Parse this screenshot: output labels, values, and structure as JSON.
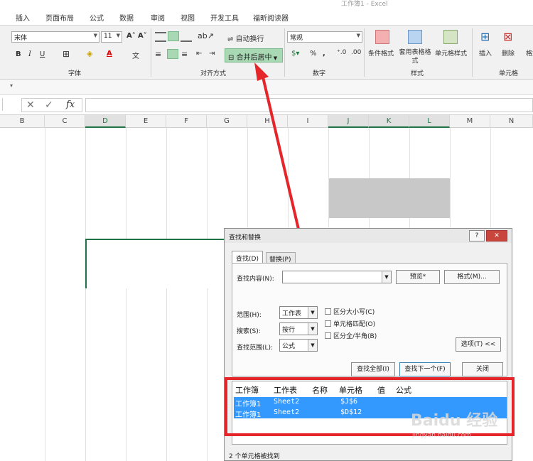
{
  "window": {
    "title": "工作簿1 - Excel"
  },
  "tabs": [
    "插入",
    "页面布局",
    "公式",
    "数据",
    "审阅",
    "视图",
    "开发工具",
    "福昕阅读器"
  ],
  "ribbon": {
    "font_name": "宋体",
    "font_size": "11",
    "wrap_text": "自动换行",
    "merge_center": "合并后居中",
    "number_format": "常规",
    "groups": {
      "font": "字体",
      "alignment": "对齐方式",
      "number": "数字",
      "styles": "样式",
      "cells": "单元格"
    },
    "cond_format": "条件格式",
    "table_format": "套用表格格式",
    "cell_style": "单元格样式",
    "insert": "插入",
    "delete": "删除",
    "format": "格式",
    "percent": "%"
  },
  "formula_bar": {
    "fx": "fx"
  },
  "columns": [
    "B",
    "C",
    "D",
    "E",
    "F",
    "G",
    "H",
    "I",
    "J",
    "K",
    "L",
    "M",
    "N"
  ],
  "dialog": {
    "title": "查找和替换",
    "help": "?",
    "tab_find": "查找(D)",
    "tab_replace": "替换(P)",
    "find_label": "查找内容(N):",
    "preview_btn": "预览*",
    "format_btn": "格式(M)...",
    "scope_label": "范围(H):",
    "scope_value": "工作表",
    "search_label": "搜索(S):",
    "search_value": "按行",
    "lookin_label": "查找范围(L):",
    "lookin_value": "公式",
    "match_case": "区分大小写(C)",
    "match_cell": "单元格匹配(O)",
    "match_width": "区分全/半角(B)",
    "options_btn": "选项(T) <<",
    "find_all_btn": "查找全部(I)",
    "find_next_btn": "查找下一个(F)",
    "close_btn": "关闭",
    "result_headers": [
      "工作簿",
      "工作表",
      "名称",
      "单元格",
      "值",
      "公式"
    ],
    "results": [
      {
        "book": "工作簿1",
        "sheet": "Sheet2",
        "cell": "$J$6"
      },
      {
        "book": "工作簿1",
        "sheet": "Sheet2",
        "cell": "$D$12"
      }
    ],
    "status": "2 个单元格被找到"
  },
  "watermark": {
    "text": "Baidu 经验",
    "sub": "jingyan.baidu.com"
  },
  "colors": {
    "accent": "#217346",
    "selection": "#3399ff",
    "highlight": "#e5252a"
  }
}
